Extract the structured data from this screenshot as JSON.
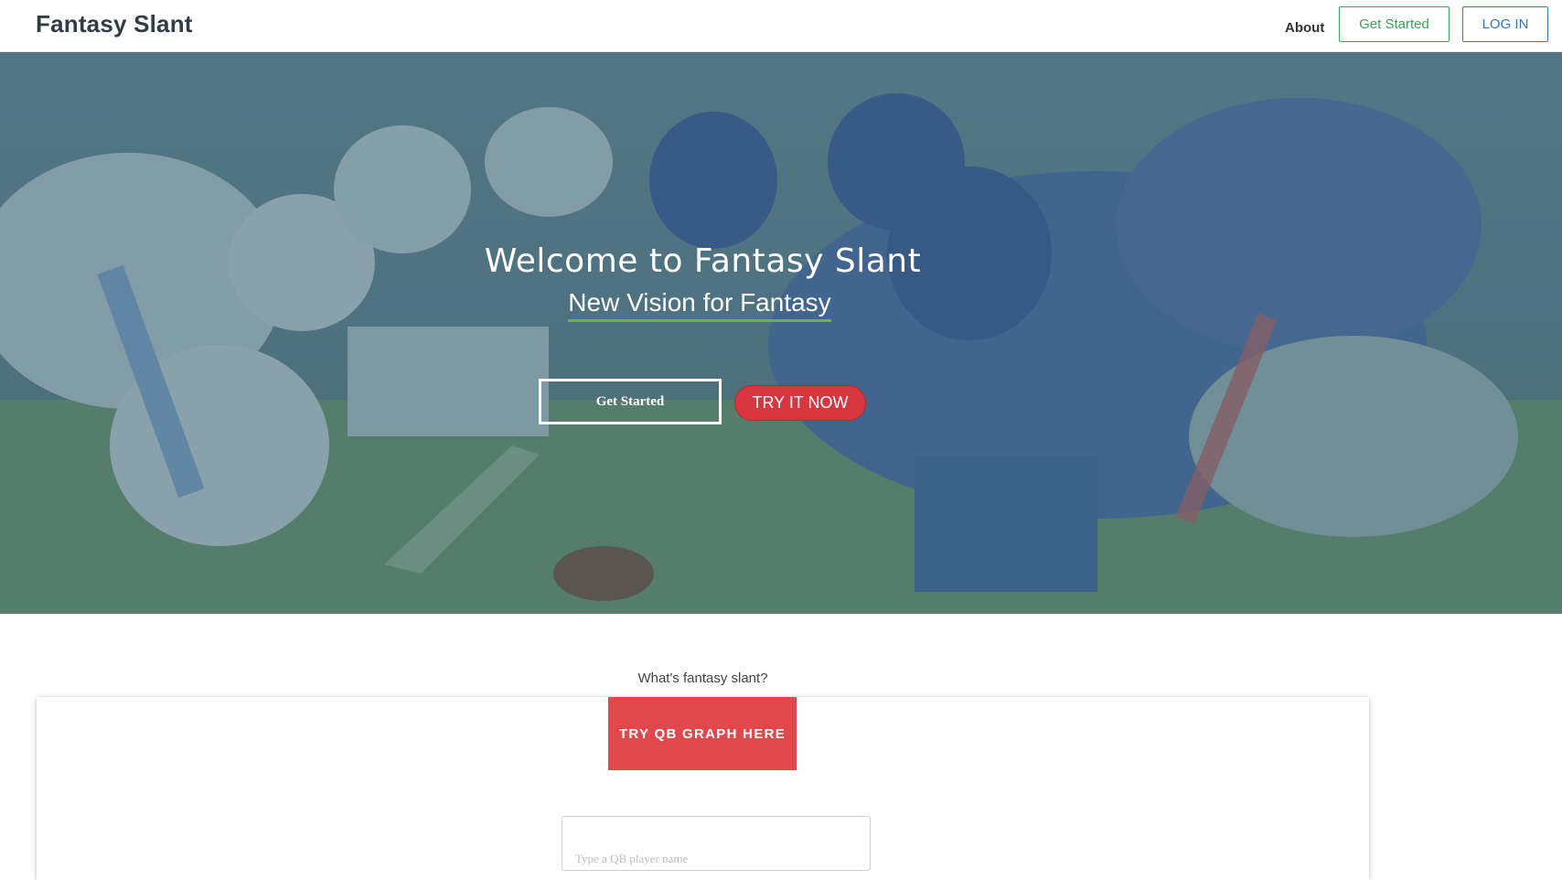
{
  "nav": {
    "brand": "Fantasy Slant",
    "about": "About",
    "get_started": "Get Started",
    "login": "LOG IN"
  },
  "hero": {
    "title": "Welcome to Fantasy Slant",
    "subtitle": "New Vision for Fantasy",
    "get_started": "Get Started",
    "try_now": "TRY IT NOW"
  },
  "section": {
    "label": "What's fantasy slant?",
    "qb_button": "TRY QB GRAPH HERE",
    "qb_placeholder": "Type a QB player name"
  },
  "colors": {
    "accent_green": "#3aa655",
    "accent_blue": "#2f78c4",
    "accent_red": "#e2474b",
    "underline_green": "#6db33f"
  }
}
